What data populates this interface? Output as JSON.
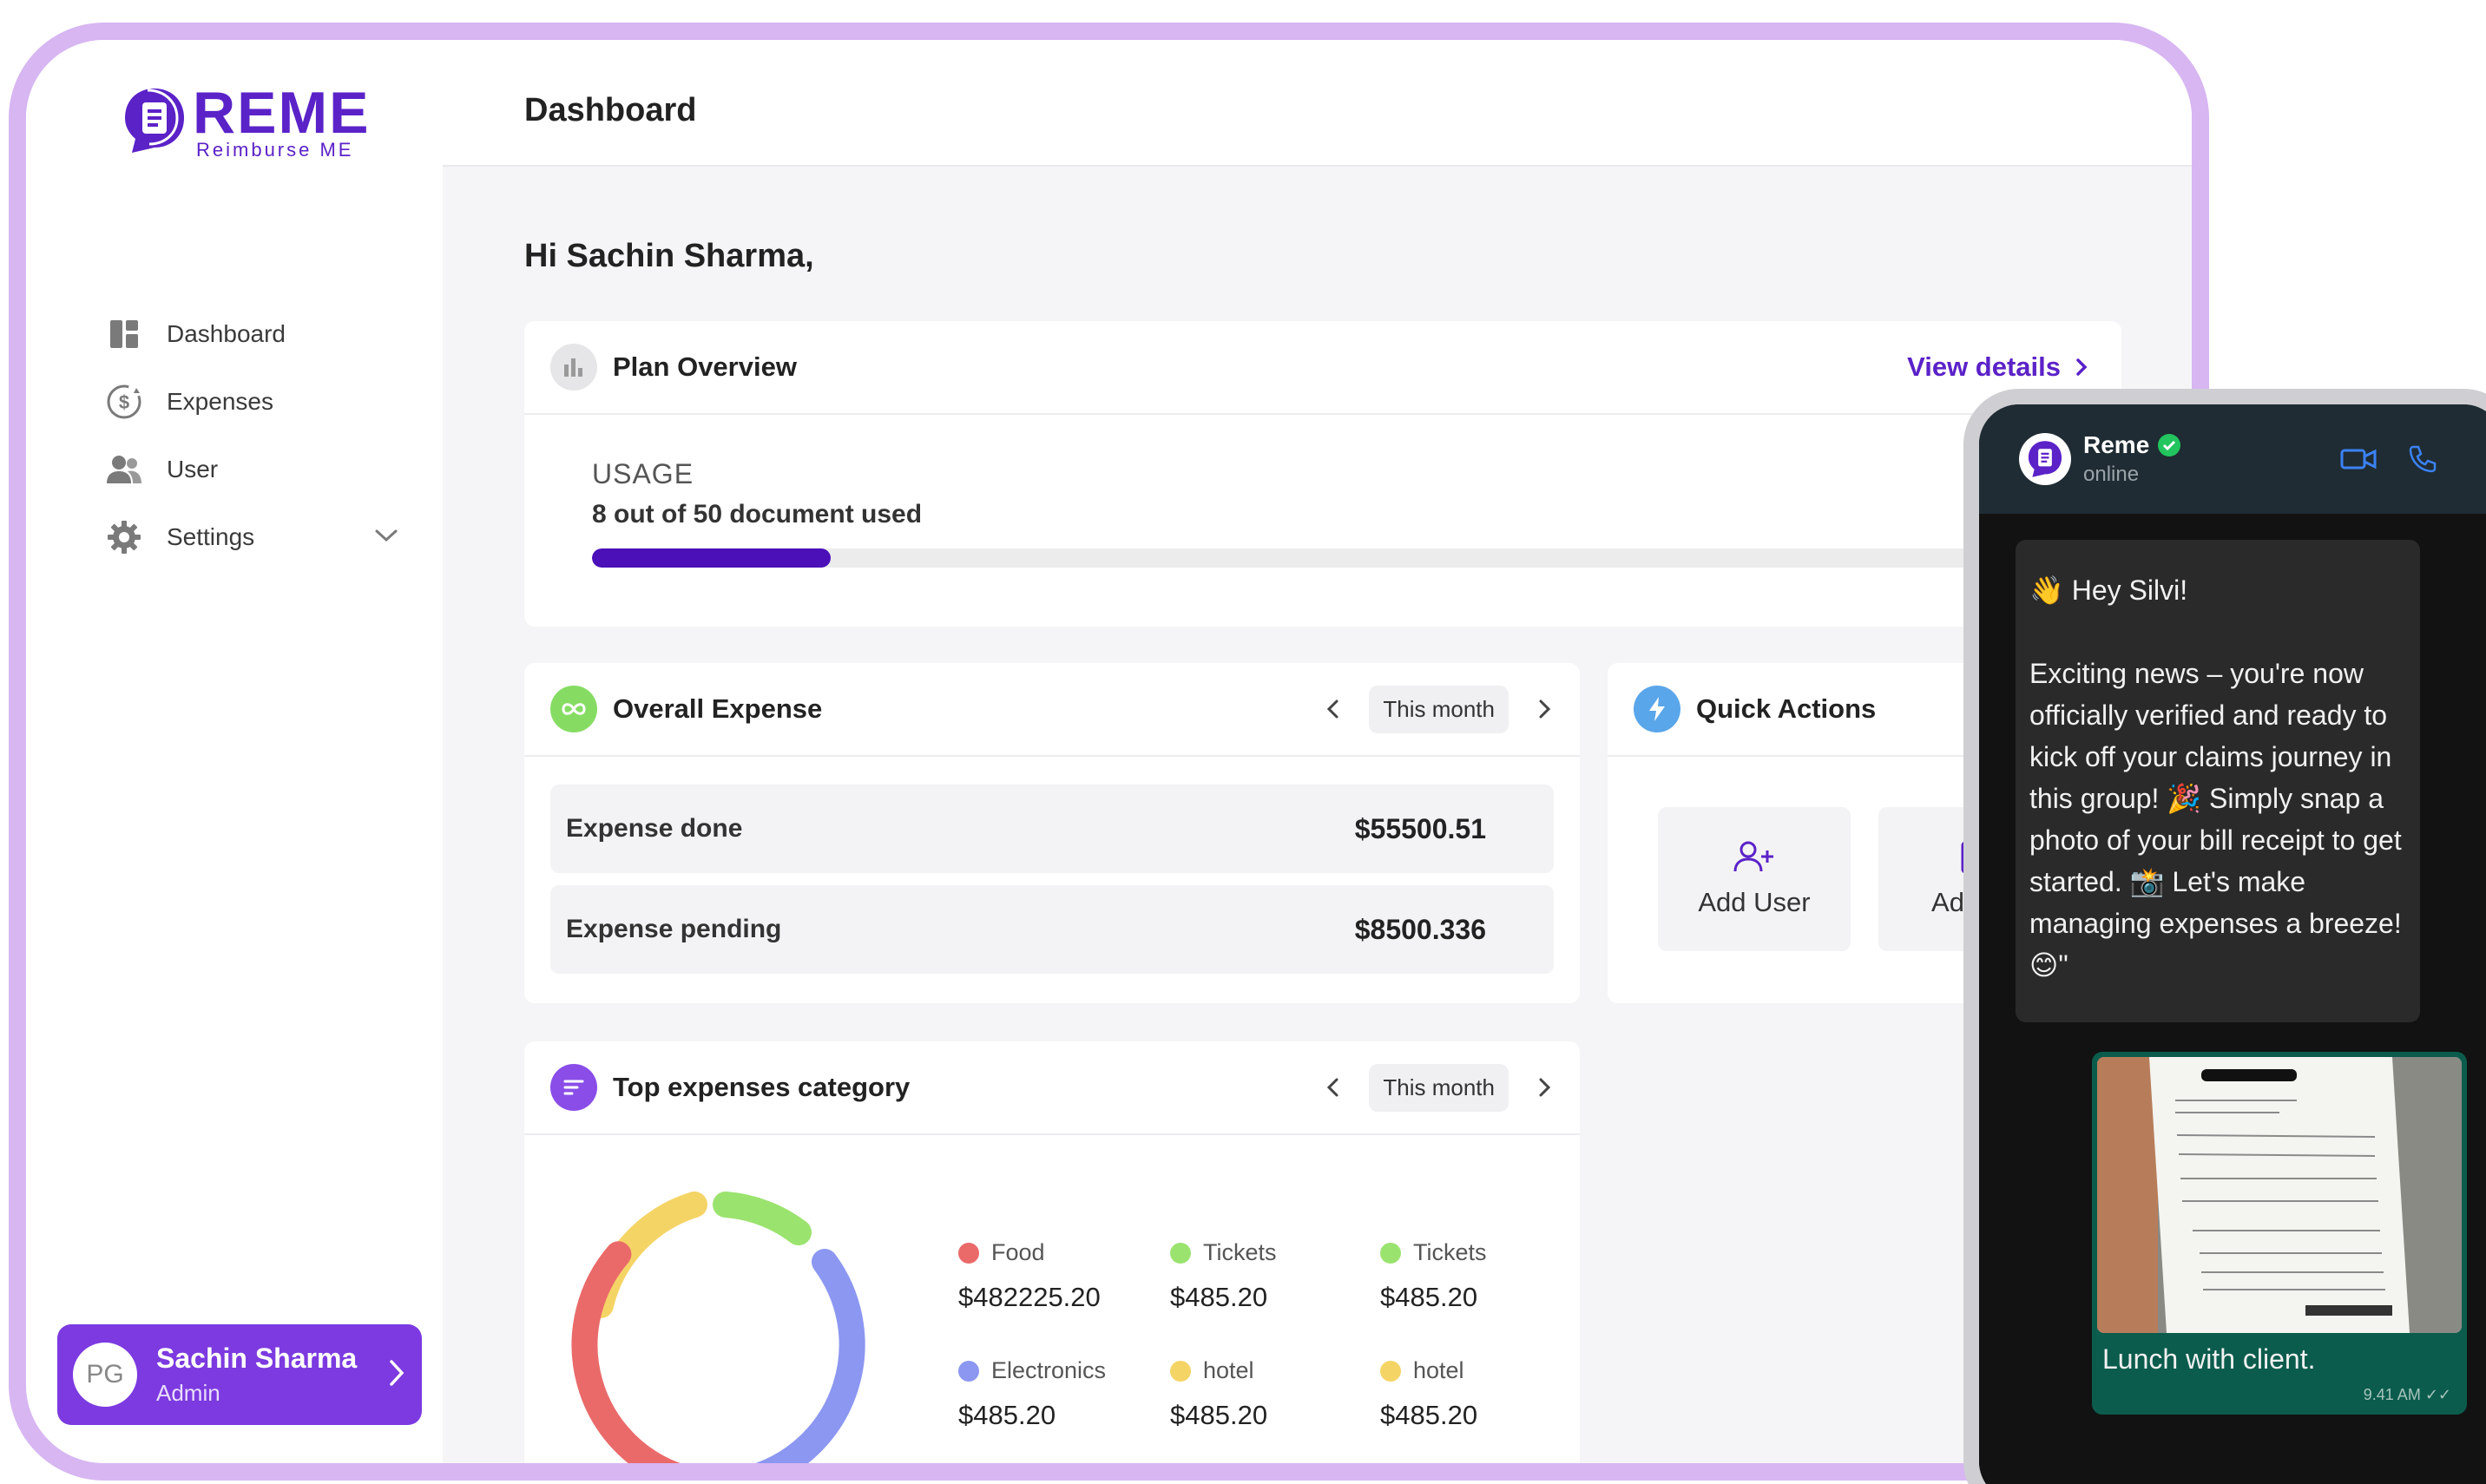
{
  "app": {
    "logo_word": "REME",
    "logo_tagline": "Reimburse ME",
    "brand_color": "#5b22c8"
  },
  "header": {
    "title": "Dashboard"
  },
  "sidebar": {
    "items": [
      {
        "label": "Dashboard",
        "icon": "dashboard-icon"
      },
      {
        "label": "Expenses",
        "icon": "expenses-icon"
      },
      {
        "label": "User",
        "icon": "user-icon"
      },
      {
        "label": "Settings",
        "icon": "gear-icon"
      }
    ],
    "user": {
      "initials": "PG",
      "name": "Sachin Sharma",
      "role": "Admin"
    }
  },
  "main": {
    "greeting": "Hi  Sachin Sharma,",
    "plan": {
      "title": "Plan Overview",
      "view_details": "View details",
      "usage_label": "USAGE",
      "usage_text": "8 out of 50 document used",
      "usage_fraction": 0.16
    },
    "expense": {
      "title": "Overall Expense",
      "period": "This month",
      "rows": [
        {
          "label": "Expense done",
          "value": "$55500.51"
        },
        {
          "label": "Expense pending",
          "value": "$8500.336"
        }
      ]
    },
    "quick_actions": {
      "title": "Quick Actions",
      "tiles": [
        {
          "label": "Add User"
        },
        {
          "label": "Add Ex"
        }
      ]
    },
    "top_category": {
      "title": "Top expenses category",
      "period": "This month",
      "legend": [
        {
          "name": "Food",
          "value": "$482225.20",
          "color": "#ea6a6a"
        },
        {
          "name": "Tickets",
          "value": "$485.20",
          "color": "#9be36f"
        },
        {
          "name": "Tickets",
          "value": "$485.20",
          "color": "#9be36f"
        },
        {
          "name": "Electronics",
          "value": "$485.20",
          "color": "#8c97f2"
        },
        {
          "name": "hotel",
          "value": "$485.20",
          "color": "#f5d466"
        },
        {
          "name": "hotel",
          "value": "$485.20",
          "color": "#f5d466"
        }
      ]
    }
  },
  "chat": {
    "contact": "Reme",
    "status": "online",
    "message": [
      "👋 Hey Silvi!",
      "",
      "Exciting news – you're now officially verified and ready to kick off your claims journey in this group! 🎉 Simply snap a photo of your bill receipt to get started. 📸 Let's make managing expenses a breeze! 😊\""
    ],
    "reply_caption": "Lunch with client.",
    "reply_time": "9.41 AM"
  }
}
